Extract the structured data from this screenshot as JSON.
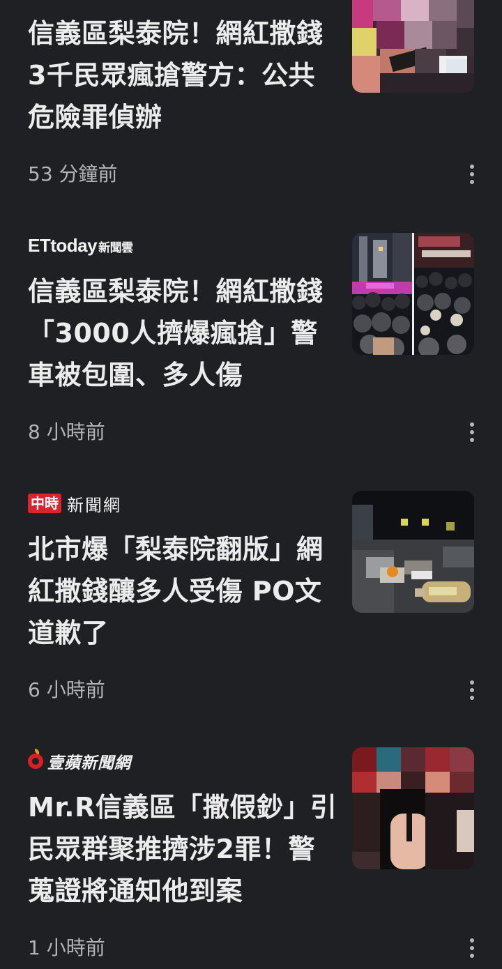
{
  "articles": [
    {
      "source": "",
      "headline": "信義區梨泰院！網紅撒錢3千民眾瘋搶警方：公共危險罪偵辦",
      "time": "53 分鐘前"
    },
    {
      "source": "ETtoday新聞雲",
      "source_main": "ETtoday",
      "source_sub": "新聞雲",
      "headline": "信義區梨泰院！網紅撒錢「3000人擠爆瘋搶」警車被包圍、多人傷",
      "time": "8 小時前"
    },
    {
      "source": "中時新聞網",
      "source_badge": "中時",
      "source_text": "新聞網",
      "headline": "北市爆「梨泰院翻版」網紅撒錢釀多人受傷 PO文道歉了",
      "time": "6 小時前"
    },
    {
      "source": "壹蘋新聞網",
      "headline": "Mr.R信義區「撒假鈔」引民眾群聚推擠涉2罪！警蒐證將通知他到案",
      "time": "1 小時前"
    }
  ],
  "icons": {
    "more": "more-vert-icon",
    "logo_apple": "apple-icon"
  },
  "colors": {
    "background": "#1f2023",
    "headline": "#ececec",
    "meta": "#b4b4b4",
    "chinatimes_red": "#d9232e",
    "nextapple_red": "#d91f26"
  }
}
